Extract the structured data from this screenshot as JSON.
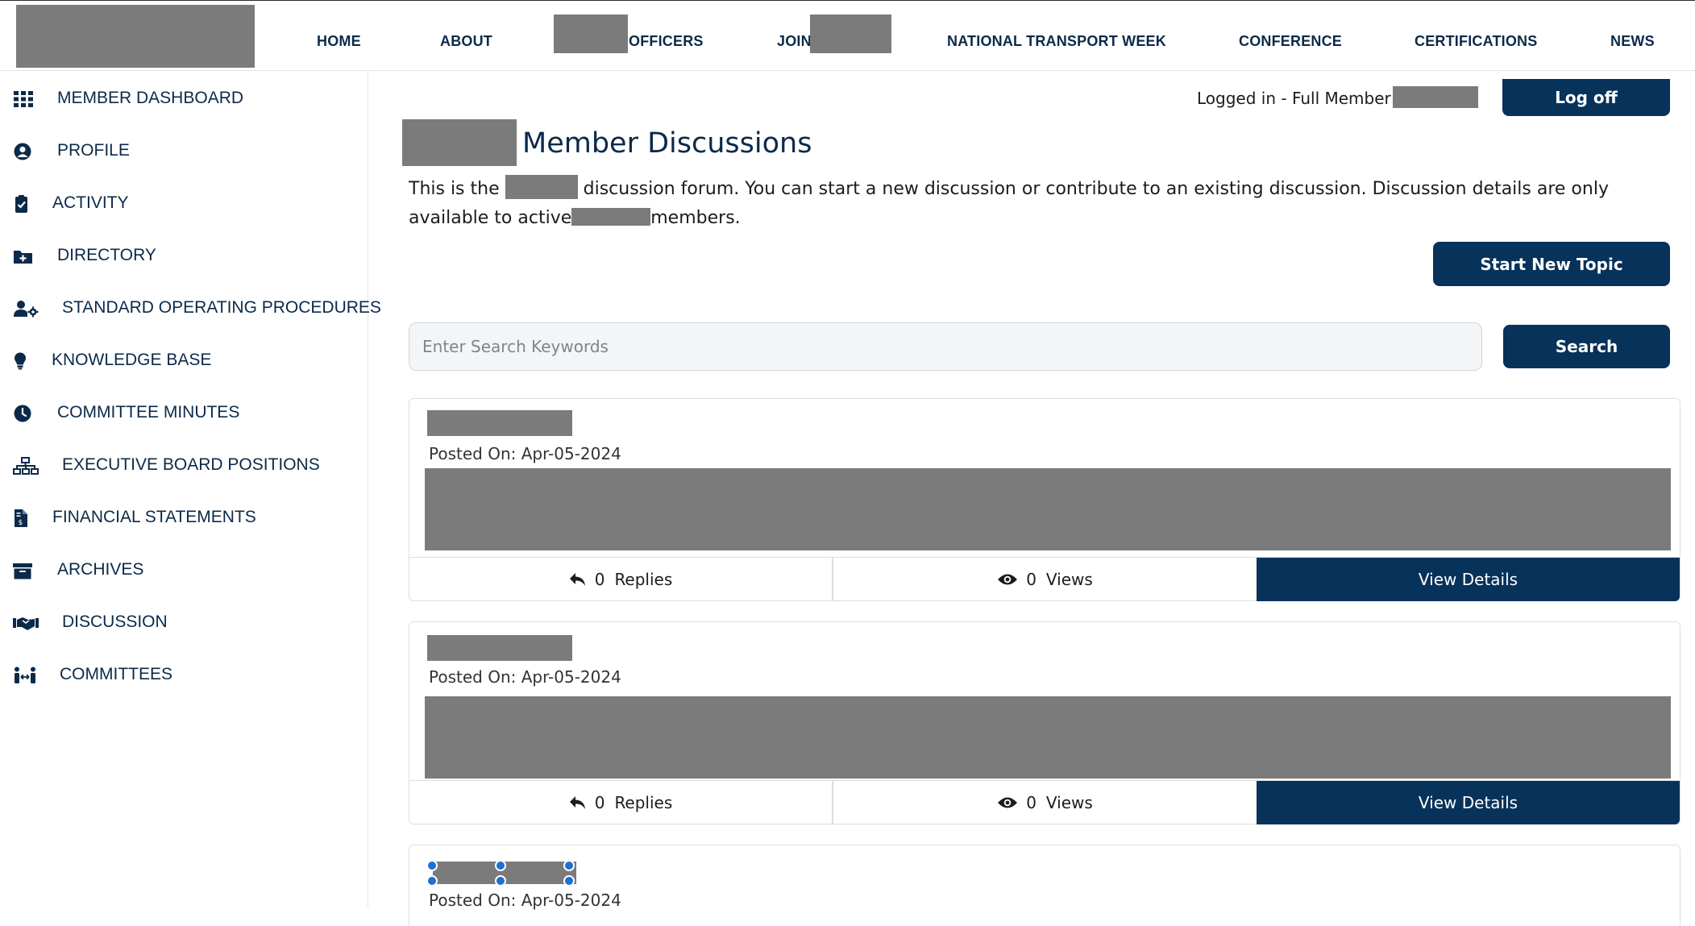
{
  "header": {
    "nav": [
      {
        "label": "HOME"
      },
      {
        "label": "ABOUT"
      },
      {
        "label": "OFFICERS"
      },
      {
        "label": "JOIN"
      },
      {
        "label": "NATIONAL TRANSPORT WEEK"
      },
      {
        "label": "CONFERENCE"
      },
      {
        "label": "CERTIFICATIONS"
      },
      {
        "label": "NEWS"
      }
    ]
  },
  "sidebar": {
    "items": [
      {
        "label": "MEMBER DASHBOARD",
        "icon": "grid-icon"
      },
      {
        "label": "PROFILE",
        "icon": "user-circle-icon"
      },
      {
        "label": "ACTIVITY",
        "icon": "clipboard-check-icon"
      },
      {
        "label": "DIRECTORY",
        "icon": "folder-plus-icon"
      },
      {
        "label": "STANDARD OPERATING PROCEDURES",
        "icon": "user-gear-icon"
      },
      {
        "label": "KNOWLEDGE BASE",
        "icon": "lightbulb-icon"
      },
      {
        "label": "COMMITTEE MINUTES",
        "icon": "clock-icon"
      },
      {
        "label": "EXECUTIVE BOARD POSITIONS",
        "icon": "sitemap-icon"
      },
      {
        "label": "FINANCIAL STATEMENTS",
        "icon": "invoice-dollar-icon"
      },
      {
        "label": "ARCHIVES",
        "icon": "archive-box-icon"
      },
      {
        "label": "DISCUSSION",
        "icon": "handshake-icon"
      },
      {
        "label": "COMMITTEES",
        "icon": "people-arrows-icon"
      }
    ]
  },
  "account": {
    "logged_in_text": "Logged in - Full Member :",
    "logoff_label": "Log off"
  },
  "main": {
    "title": "Member Discussions",
    "intro_part1": "This is the",
    "intro_part2": "discussion forum. You can start a new discussion or contribute to an existing discussion. Discussion details are only available to active",
    "intro_part3": "members.",
    "start_topic_label": "Start New Topic",
    "search_placeholder": "Enter Search Keywords",
    "search_label": "Search"
  },
  "posts": [
    {
      "posted_on": "Posted On: Apr-05-2024",
      "replies": "0",
      "replies_label": "Replies",
      "views": "0",
      "views_label": "Views",
      "details_label": "View Details"
    },
    {
      "posted_on": "Posted On: Apr-05-2024",
      "replies": "0",
      "replies_label": "Replies",
      "views": "0",
      "views_label": "Views",
      "details_label": "View Details"
    },
    {
      "posted_on": "Posted On: Apr-05-2024"
    }
  ],
  "colors": {
    "primary": "#07325a",
    "text": "#0b2a4a",
    "redaction": "#7b7b7b"
  }
}
